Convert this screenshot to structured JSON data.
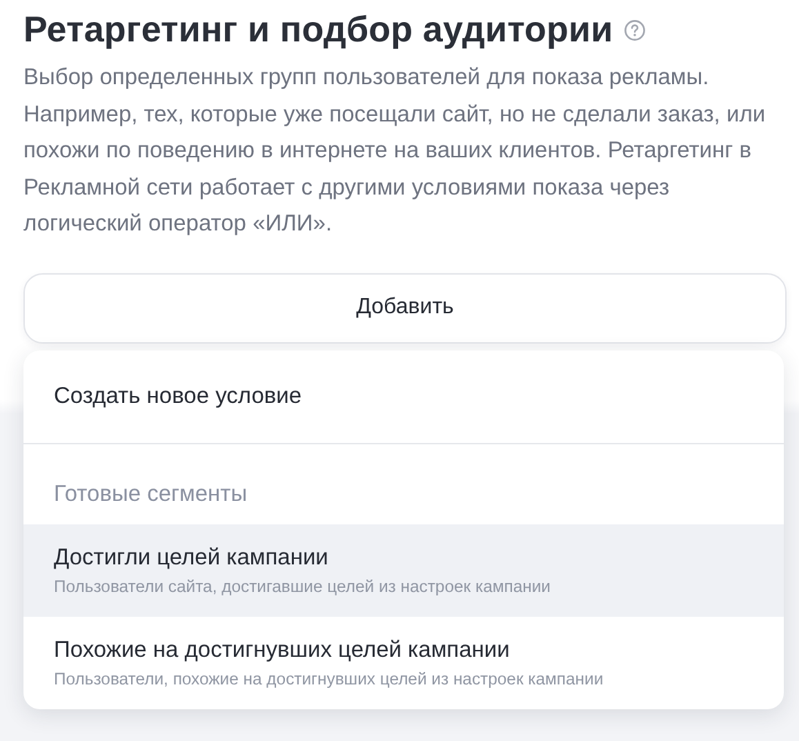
{
  "section": {
    "title": "Ретаргетинг и подбор аудитории",
    "has_help": true,
    "description": "Выбор определенных групп пользователей для показа рекламы. Например, тех, которые уже посещали сайт, но не сделали заказ, или похожи по поведению в интернете на ваших клиентов. Ретаргетинг в Рекламной сети работает с другими условиями показа через логический оператор «ИЛИ»."
  },
  "add_button": {
    "label": "Добавить"
  },
  "menu": {
    "items": [
      {
        "kind": "action",
        "label": "Создать новое условие"
      },
      {
        "kind": "divider"
      },
      {
        "kind": "header",
        "label": "Готовые сегменты"
      },
      {
        "kind": "option",
        "label": "Достигли целей кампании",
        "hint": "Пользователи сайта, достигавшие целей из настроек кампании",
        "selected": true
      },
      {
        "kind": "option",
        "label": "Похожие на достигнувших целей кампании",
        "hint": "Пользователи, похожие на достигнувших целей из настроек кампании",
        "selected": false
      }
    ]
  }
}
